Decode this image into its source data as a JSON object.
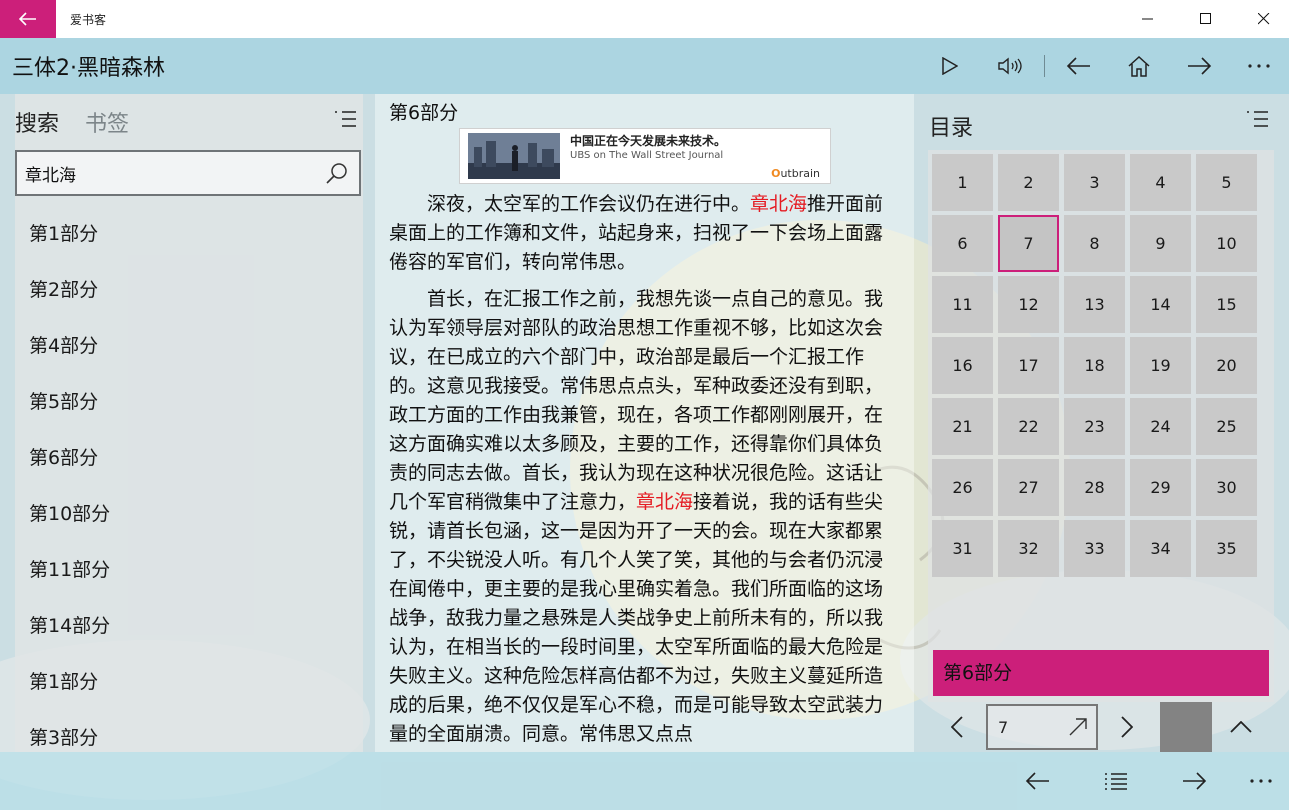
{
  "app": {
    "window_title": "爱书客",
    "book_title": "三体2·黑暗森林"
  },
  "header_tools": [
    "play-icon",
    "volume-icon",
    "arrow-left-icon",
    "home-icon",
    "arrow-right-icon",
    "more-icon"
  ],
  "left_panel": {
    "tabs": [
      "搜索",
      "书签"
    ],
    "active_tab": "搜索",
    "search": {
      "value": "章北海",
      "placeholder": ""
    },
    "results": [
      "第1部分",
      "第2部分",
      "第4部分",
      "第5部分",
      "第6部分",
      "第10部分",
      "第11部分",
      "第14部分",
      "第1部分",
      "第3部分"
    ]
  },
  "reader": {
    "chapter": "第6部分",
    "ad": {
      "title": "中国正在今天发展未来技术。",
      "source": "UBS on The Wall Street Journal",
      "brand_prefix": "O",
      "brand_rest": "utbrain"
    },
    "highlight_term": "章北海",
    "paragraphs": [
      [
        "深夜，太空军的工作会议仍在进行中。",
        "章北海",
        "推开面前桌面上的工作簿和文件，站起身来，扫视了一下会场上面露倦容的军官们，转向常伟思。"
      ],
      [
        "首长，在汇报工作之前，我想先谈一点自己的意见。我认为军领导层对部队的政治思想工作重视不够，比如这次会议，在已成立的六个部门中，政治部是最后一个汇报工作的。这意见我接受。常伟思点点头，军种政委还没有到职，政工方面的工作由我兼管，现在，各项工作都刚刚展开，在这方面确实难以太多顾及，主要的工作，还得靠你们具体负责的同志去做。首长，我认为现在这种状况很危险。这话让几个军官稍微集中了注意力，",
        "章北海",
        "接着说，我的话有些尖锐，请首长包涵，这一是因为开了一天的会。现在大家都累了，不尖锐没人听。有几个人笑了笑，其他的与会者仍沉浸在闻倦中，更主要的是我心里确实着急。我们所面临的这场战争，敌我力量之悬殊是人类战争史上前所未有的，所以我认为，在相当长的一段时间里，太空军所面临的最大危险是失败主义。这种危险怎样高估都不为过，失败主义蔓延所造成的后果，绝不仅仅是军心不稳，而是可能导致太空武装力量的全面崩溃。同意。常伟思又点点"
      ]
    ]
  },
  "right_panel": {
    "title": "目录",
    "pages": [
      "1",
      "2",
      "3",
      "4",
      "5",
      "6",
      "7",
      "8",
      "9",
      "10",
      "11",
      "12",
      "13",
      "14",
      "15",
      "16",
      "17",
      "18",
      "19",
      "20",
      "21",
      "22",
      "23",
      "24",
      "25",
      "26",
      "27",
      "28",
      "29",
      "30",
      "31",
      "32",
      "33",
      "34",
      "35"
    ],
    "selected_page": "7",
    "current_chapter": "第6部分",
    "page_input_value": "7"
  },
  "bottom_tools": [
    "arrow-left-icon",
    "list-icon",
    "arrow-right-icon",
    "more-icon"
  ],
  "colors": {
    "accent": "#cc1f7a",
    "highlight": "#e51c23",
    "header_bg": "#aad4e0"
  }
}
